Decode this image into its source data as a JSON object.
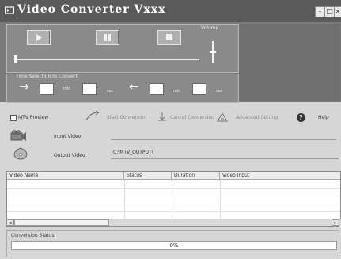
{
  "app": {
    "title": "Video Converter Vxxx"
  },
  "window_buttons": {
    "minimize": "-",
    "maximize": "□",
    "close": "×"
  },
  "player": {
    "volume_label": "Volume",
    "seek_position": 0,
    "volume_level": 0.45
  },
  "time_selection": {
    "label": "Time Selection to Convert",
    "start_min_label": "min",
    "start_sec_label": "sec",
    "end_min_label": "min",
    "end_sec_label": "sec",
    "start_min": "",
    "start_sec": "",
    "end_min": "",
    "end_sec": ""
  },
  "toolbar": {
    "mtv_preview": "MTV Preview",
    "mtv_checked": false,
    "start_conversion": "Start Conversion",
    "cancel_conversion": "Cancel Conversion",
    "advanced_setting": "Advanced Setting",
    "help": "Help"
  },
  "io": {
    "input_label": "Input Video",
    "input_value": "",
    "output_label": "Output Video",
    "output_value": "C:\\MTV_OUTPUT\\"
  },
  "table": {
    "columns": [
      "Video Name",
      "Status",
      "Duration",
      "Video Input"
    ],
    "rows": []
  },
  "status": {
    "label": "Conversion Status",
    "progress_text": "0%",
    "progress_value": 0
  },
  "icons": {
    "app": "film-icon",
    "play": "play-icon",
    "pause": "pause-icon",
    "stop": "stop-icon",
    "start": "start-conversion-icon",
    "cancel": "cancel-conversion-icon",
    "advanced": "advanced-setting-icon",
    "help": "help-icon",
    "input": "camcorder-icon",
    "output": "disc-icon"
  },
  "colors": {
    "accent_progress": "#4a7fd0",
    "titlebar": "#5a5a5a"
  }
}
